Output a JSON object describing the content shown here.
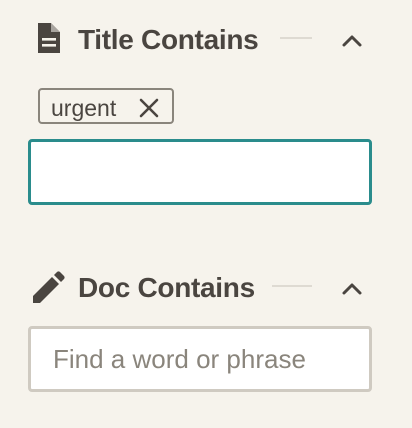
{
  "title_section": {
    "title": "Title Contains",
    "icon": "document-icon",
    "chips": [
      {
        "label": "urgent"
      }
    ],
    "input": {
      "value": "",
      "placeholder": ""
    }
  },
  "doc_section": {
    "title": "Doc Contains",
    "icon": "pencil-icon",
    "input": {
      "value": "",
      "placeholder": "Find a word or phrase"
    }
  },
  "colors": {
    "background": "#f6f3ec",
    "text": "#4a4540",
    "focus_border": "#2a8c8c",
    "input_border": "#cfcac1",
    "chip_border": "#8a857c"
  }
}
